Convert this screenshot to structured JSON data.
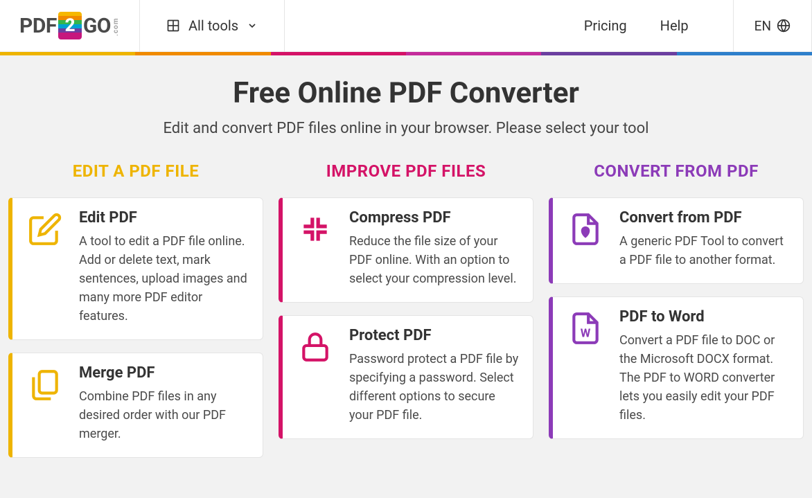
{
  "nav": {
    "all_tools": "All tools",
    "pricing": "Pricing",
    "help": "Help",
    "lang": "EN"
  },
  "logo": {
    "p1": "PDF",
    "p2": "2",
    "p3": "GO",
    "p4": ".com"
  },
  "hero": {
    "title": "Free Online PDF Converter",
    "subtitle": "Edit and convert PDF files online in your browser. Please select your tool"
  },
  "columns": [
    {
      "title": "EDIT A PDF FILE",
      "cards": [
        {
          "title": "Edit PDF",
          "desc": "A tool to edit a PDF file online. Add or delete text, mark sentences, upload images and many more PDF editor features."
        },
        {
          "title": "Merge PDF",
          "desc": "Combine PDF files in any desired order with our PDF merger."
        }
      ]
    },
    {
      "title": "IMPROVE PDF FILES",
      "cards": [
        {
          "title": "Compress PDF",
          "desc": "Reduce the file size of your PDF online. With an option to select your compression level."
        },
        {
          "title": "Protect PDF",
          "desc": "Password protect a PDF file by specifying a password. Select different options to secure your PDF file."
        }
      ]
    },
    {
      "title": "CONVERT FROM PDF",
      "cards": [
        {
          "title": "Convert from PDF",
          "desc": "A generic PDF Tool to convert a PDF file to another format."
        },
        {
          "title": "PDF to Word",
          "desc": "Convert a PDF file to DOC or the Microsoft DOCX format. The PDF to WORD converter lets you easily edit your PDF files."
        }
      ]
    }
  ],
  "rainbow_colors": [
    "#EEB400",
    "#F08A00",
    "#D41367",
    "#C42C9B",
    "#6B3FA0",
    "#2E7FCB"
  ]
}
